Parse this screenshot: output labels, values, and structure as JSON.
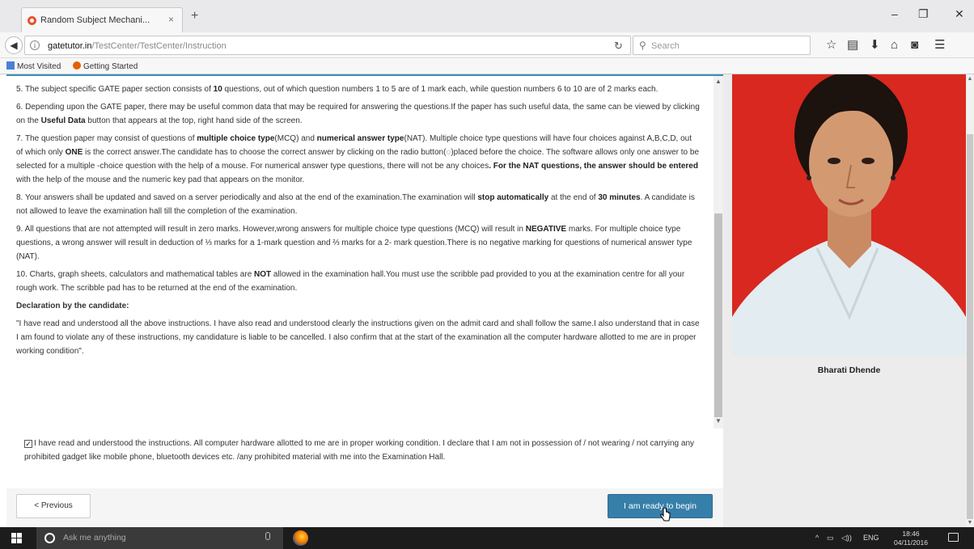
{
  "browser": {
    "tab_title": "Random Subject Mechani...",
    "tab_close": "×",
    "new_tab": "+",
    "url_host": "gatetutor.in",
    "url_path": "/TestCenter/TestCenter/Instruction",
    "search_placeholder": "Search",
    "bookmarks": [
      "Most Visited",
      "Getting Started"
    ]
  },
  "instructions": {
    "items": [
      {
        "segments": [
          {
            "t": "5. The subject specific GATE paper section consists of "
          },
          {
            "t": "10",
            "b": true
          },
          {
            "t": " questions, out of which question numbers 1 to 5 are of 1 mark each, while question numbers 6 to 10 are of 2 marks each."
          }
        ]
      },
      {
        "segments": [
          {
            "t": "6. Depending upon the GATE paper, there may be useful common data that may be required for answering the questions.If the paper has such useful data, the same can be viewed by clicking on the "
          },
          {
            "t": "Useful Data",
            "b": true
          },
          {
            "t": " button that appears at the top, right hand side of the screen."
          }
        ]
      },
      {
        "segments": [
          {
            "t": "7. The question paper may consist of questions of "
          },
          {
            "t": "multiple choice type",
            "b": true
          },
          {
            "t": "(MCQ) and "
          },
          {
            "t": "numerical answer type",
            "b": true
          },
          {
            "t": "(NAT). Multiple choice type questions will have four choices against A,B,C,D, out of which only "
          },
          {
            "t": "ONE",
            "b": true
          },
          {
            "t": " is the correct answer.The candidate has to choose the correct answer by clicking on the radio button(◌)placed before the choice. The software allows only one answer to be selected for a multiple -choice question with the help of a mouse. For numerical answer type questions, there will not be any choices"
          },
          {
            "t": ". For the NAT questions, the answer should be entered",
            "b": true
          },
          {
            "t": " with the help of the mouse and the numeric key pad that appears on the monitor."
          }
        ]
      },
      {
        "segments": [
          {
            "t": "8. Your answers shall be updated and saved on a server periodically and also at the end of the examination.The examination will "
          },
          {
            "t": "stop automatically",
            "b": true
          },
          {
            "t": " at the end of "
          },
          {
            "t": "30 minutes",
            "b": true
          },
          {
            "t": ". A candidate is not allowed to leave the examination hall till the completion of the examination."
          }
        ]
      },
      {
        "segments": [
          {
            "t": "9. All questions that are not attempted will result in zero marks. However,wrong answers for multiple choice type questions (MCQ) will result in "
          },
          {
            "t": "NEGATIVE",
            "b": true
          },
          {
            "t": " marks. For multiple choice type questions, a wrong answer will result in deduction of ⅓ marks for a 1-mark question and ⅔ marks for a 2- mark question.There is no negative marking for questions of numerical answer type (NAT)."
          }
        ]
      },
      {
        "segments": [
          {
            "t": "10. Charts, graph sheets, calculators and mathematical tables are "
          },
          {
            "t": "NOT",
            "b": true
          },
          {
            "t": " allowed in the examination hall.You must use the scribble pad provided to you at the examination centre for all your rough work. The scribble pad has to be returned at the end of the examination."
          }
        ]
      }
    ],
    "declaration_title": "Declaration by the candidate:",
    "declaration_text": "\"I have read and understood all the above instructions. I have also read and understood clearly the instructions given on the admit card and shall follow the same.I also understand that in case I am found to violate any of these instructions, my candidature is liable to be cancelled. I also confirm that at the start of the examination all the computer hardware allotted to me are in proper working condition\"."
  },
  "agreement": {
    "checked": true,
    "check_glyph": "✓",
    "text": "I have read and understood the instructions. All computer hardware allotted to me are in proper working condition. I declare that I am not in possession of / not wearing / not carrying any prohibited gadget like mobile phone, bluetooth devices etc. /any prohibited material with me into the Examination Hall."
  },
  "buttons": {
    "previous": "< Previous",
    "begin": "I am ready to begin"
  },
  "candidate": {
    "name": "Bharati Dhende"
  },
  "taskbar": {
    "search_placeholder": "Ask me anything",
    "language": "ENG",
    "time": "18:46",
    "date": "04/11/2016"
  },
  "colors": {
    "accent": "#3c8dbc",
    "begin_button": "#367fa9",
    "photo_background": "#d8281f"
  }
}
